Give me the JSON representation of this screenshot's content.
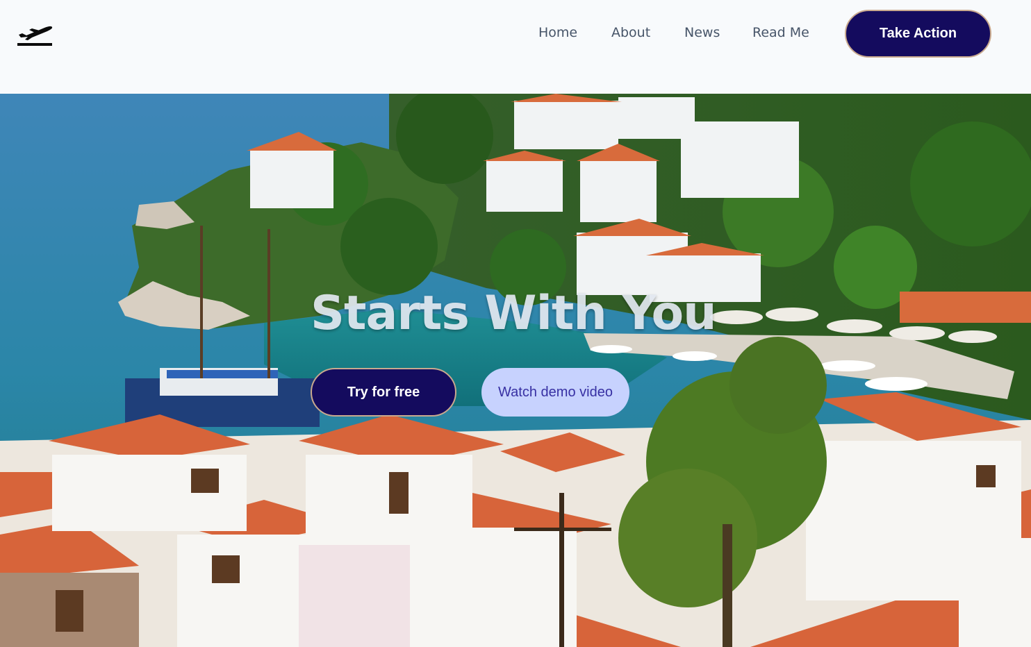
{
  "brand": {
    "icon": "airplane-departure-icon"
  },
  "nav": {
    "items": [
      "Home",
      "About",
      "News",
      "Read Me"
    ],
    "cta_label": "Take Action"
  },
  "hero": {
    "title": "Starts With You",
    "primary_button": "Try for free",
    "secondary_button": "Watch demo video",
    "background": "coastal-village-harbor-photo"
  },
  "colors": {
    "page_bg": "#f8fafc",
    "nav_text": "#475569",
    "primary_button_bg": "#140b5e",
    "primary_button_border": "#c9a98e",
    "secondary_button_bg": "#c7d2fe",
    "secondary_button_text": "#3730a3",
    "title_text": "#e2e8f0"
  }
}
